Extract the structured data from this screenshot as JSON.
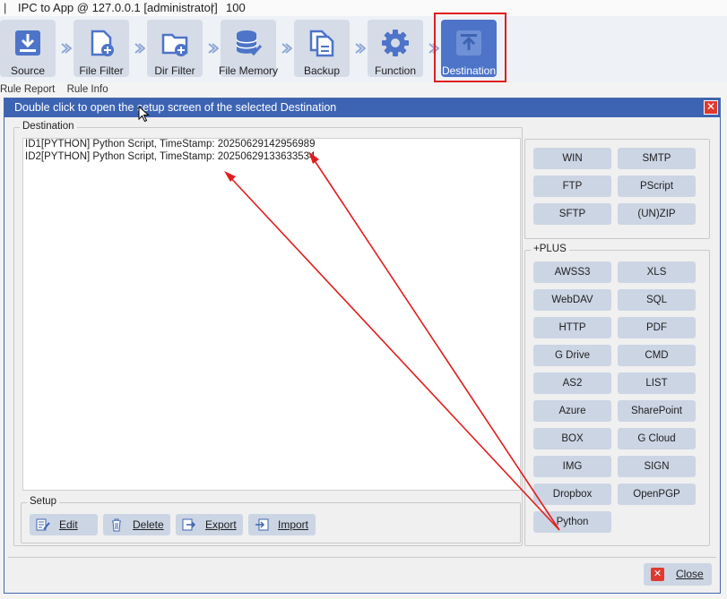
{
  "app": {
    "title": "IPC to App @ 127.0.0.1 [administrator]",
    "count": "100"
  },
  "toolbar": {
    "source": "Source",
    "file_filter": "File Filter",
    "dir_filter": "Dir Filter",
    "file_memory": "File Memory",
    "backup": "Backup",
    "function": "Function",
    "destination": "Destination"
  },
  "tabs": {
    "rule_report": "Rule Report",
    "rule_info": "Rule Info"
  },
  "dialog": {
    "title": "Double click to open the setup screen of the selected Destination",
    "destination_legend": "Destination",
    "items": [
      "ID1[PYTHON] Python Script, TimeStamp: 20250629142956989",
      "ID2[PYTHON] Python Script, TimeStamp: 20250629133633534"
    ],
    "basic_buttons": [
      "WIN",
      "SMTP",
      "FTP",
      "PScript",
      "SFTP",
      "(UN)ZIP"
    ],
    "plus_legend": "+PLUS",
    "plus_buttons": [
      "AWSS3",
      "XLS",
      "WebDAV",
      "SQL",
      "HTTP",
      "PDF",
      "G Drive",
      "CMD",
      "AS2",
      "LIST",
      "Azure",
      "SharePoint",
      "BOX",
      "G Cloud",
      "IMG",
      "SIGN",
      "Dropbox",
      "OpenPGP",
      "Python"
    ],
    "setup_legend": "Setup",
    "setup": {
      "edit": "Edit",
      "delete": "Delete",
      "export": "Export",
      "import": "Import"
    },
    "close": "Close"
  },
  "colors": {
    "accent": "#4d74c8",
    "highlight": "#e01e1e",
    "dialog_header": "#3d64b3"
  }
}
